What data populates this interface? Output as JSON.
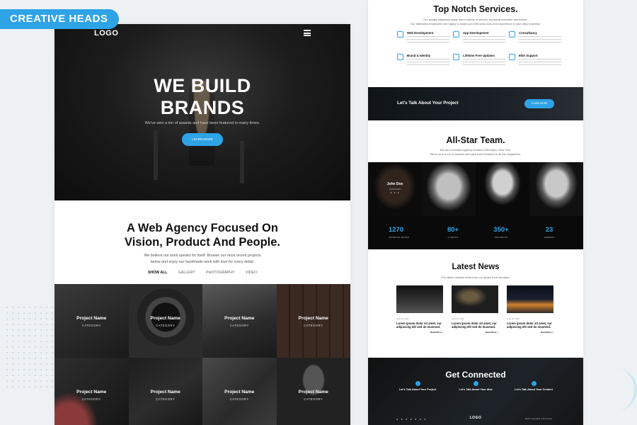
{
  "badge": "CREATIVE HEADS",
  "accent_color": "#2ea3e6",
  "left_page": {
    "logo": "LOGO",
    "menu_icon": "hamburger-icon",
    "hero": {
      "title_line1": "WE BUILD",
      "title_line2": "BRANDS",
      "subtitle": "We've won a ton of awards and have been featured in many times.",
      "button": "LEARN MORE"
    },
    "intro": {
      "title_line1": "A Web Agency Focused On",
      "title_line2": "Vision, Product And People.",
      "text_line1": "We believe our work speaks for itself. Browse our most recent projects",
      "text_line2": "below and enjoy our handmade work with love for every detail."
    },
    "filters": [
      "SHOW ALL",
      "GALLERY",
      "PHOTOGRAPHY",
      "VIDEO"
    ],
    "projects": [
      {
        "name": "Project Name",
        "category": "CATEGORY"
      },
      {
        "name": "Project Name",
        "category": "CATEGORY"
      },
      {
        "name": "Project Name",
        "category": "CATEGORY"
      },
      {
        "name": "Project Name",
        "category": "CATEGORY"
      },
      {
        "name": "Project Name",
        "category": "CATEGORY"
      },
      {
        "name": "Project Name",
        "category": "CATEGORY"
      },
      {
        "name": "Project Name",
        "category": "CATEGORY"
      },
      {
        "name": "Project Name",
        "category": "CATEGORY"
      }
    ]
  },
  "right_page": {
    "services": {
      "title": "Top Notch Services.",
      "intro_line1": "Our quality standards apply also in terms of service, technical expertise and advice.",
      "intro_line2": "Our dedicated employees are happy to assist you with know-how and experience in your daily business.",
      "items": [
        {
          "title": "Web Development",
          "icon": "code-icon"
        },
        {
          "title": "App Development",
          "icon": "mobile-icon"
        },
        {
          "title": "Consultancy",
          "icon": "chat-icon"
        },
        {
          "title": "Brand & Identity",
          "icon": "bulb-icon"
        },
        {
          "title": "Lifetime Free Updates",
          "icon": "refresh-icon"
        },
        {
          "title": "Elite Support",
          "icon": "support-icon"
        }
      ]
    },
    "talk": {
      "text": "Let's Talk About Your Project",
      "button": "LEARN MORE"
    },
    "team": {
      "title": "All-Star Team.",
      "intro_line1": "We are a creative agency located in Brooklyn, New York.",
      "intro_line2": "We've won a ton of awards and have been featured in all the magazines.",
      "featured_name": "John Doe",
      "featured_role": "DESIGNER",
      "stats": [
        {
          "value": "1270",
          "label": "THINKING EATEN"
        },
        {
          "value": "80+",
          "label": "CLIENTS"
        },
        {
          "value": "350+",
          "label": "PROJECTS"
        },
        {
          "value": "23",
          "label": "AWARDS"
        }
      ]
    },
    "news": {
      "title": "Latest News",
      "intro": "The latest creative news from our studio from Brooklyn.",
      "items": [
        {
          "date": "June 25, 2020",
          "title": "Lorem ipsum dolor sit amet, sur adipiscing elit sed do eiusmod.",
          "read": "Read More >"
        },
        {
          "date": "June 25, 2020",
          "title": "Lorem ipsum dolor sit amet, sur adipiscing elit sed do eiusmod.",
          "read": "Read More >"
        },
        {
          "date": "June 25, 2020",
          "title": "Lorem ipsum dolor sit amet, sur adipiscing elit sed do eiusmod.",
          "read": "Read More >"
        }
      ]
    },
    "connect": {
      "title": "Get Connected",
      "items": [
        {
          "title": "Let's Talk About Your Project",
          "icon": "send-icon"
        },
        {
          "title": "Let's Talk About Your Idea",
          "icon": "paper-plane-icon"
        },
        {
          "title": "Let's Talk About Your Content",
          "icon": "clipboard-icon"
        }
      ],
      "footer_logo": "LOGO",
      "copyright": "2020 Copyrights & Protected"
    }
  }
}
